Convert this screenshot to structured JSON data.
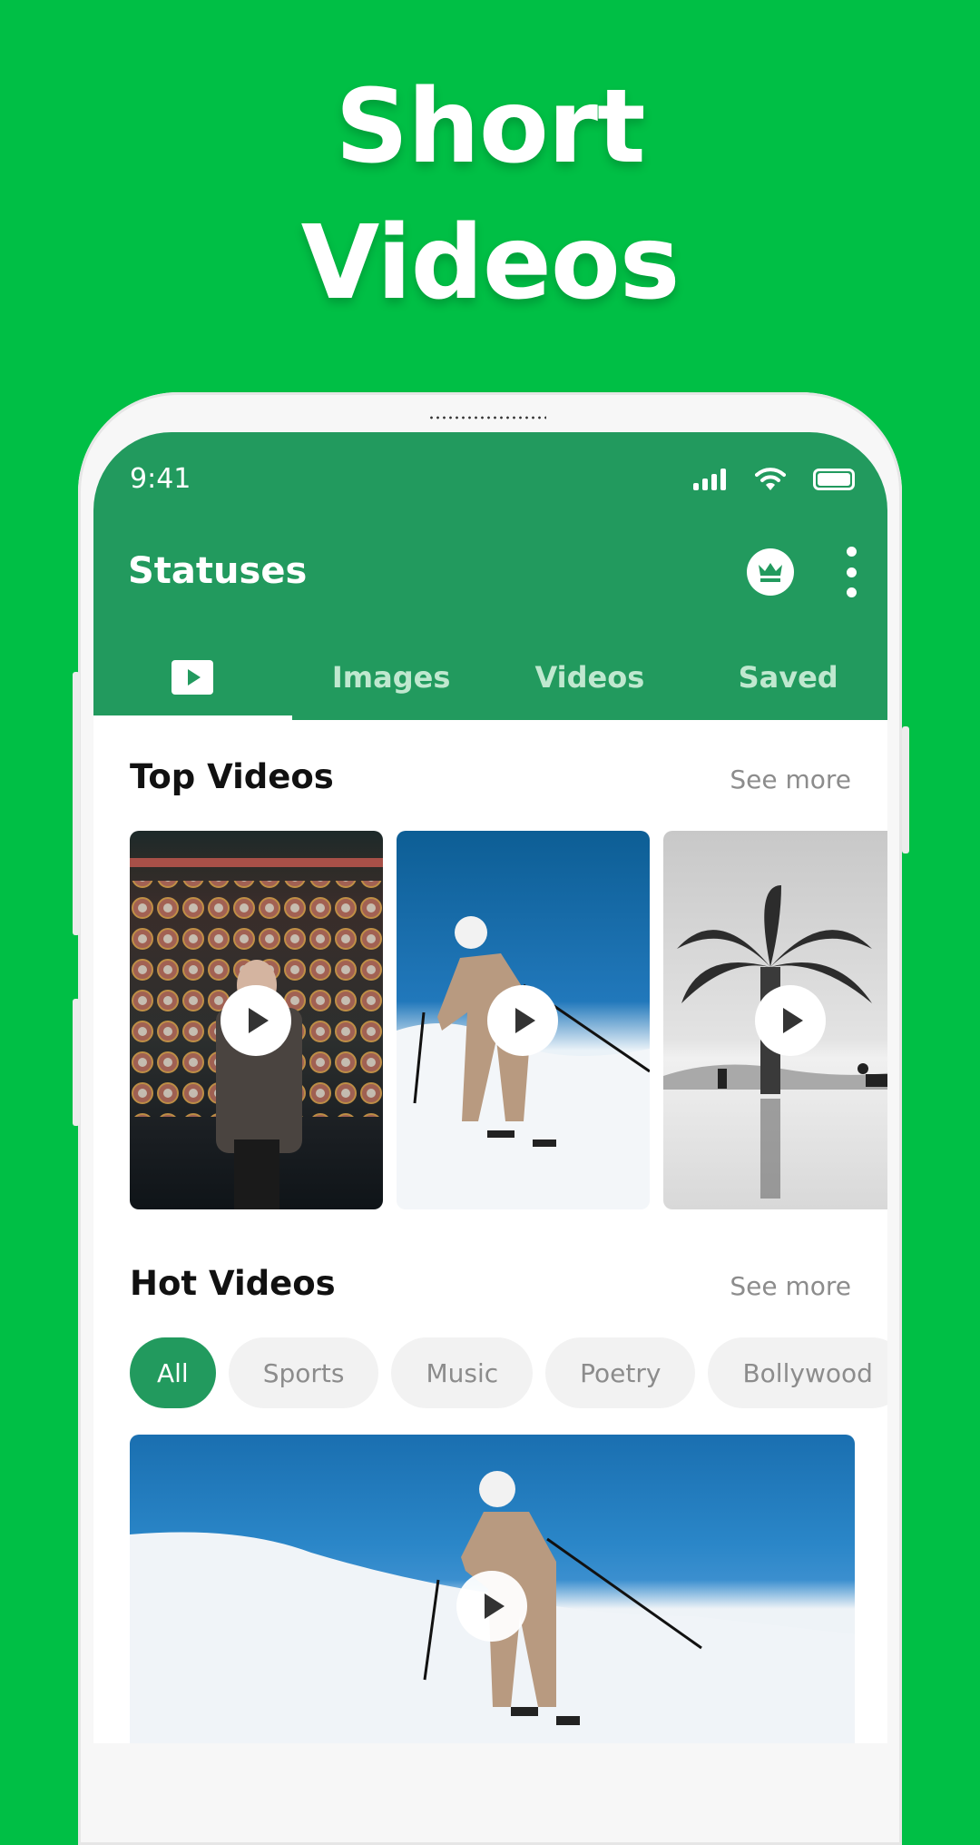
{
  "headline": {
    "line1": "Short",
    "line2": "Videos"
  },
  "status_bar": {
    "time": "9:41",
    "icons": [
      "signal-icon",
      "wifi-icon",
      "battery-icon"
    ]
  },
  "app_bar": {
    "title": "Statuses",
    "premium_icon": "crown-icon",
    "menu_icon": "more-vertical-icon"
  },
  "tabs": [
    {
      "label": "",
      "icon": "play-icon",
      "active": true
    },
    {
      "label": "Images",
      "active": false
    },
    {
      "label": "Videos",
      "active": false
    },
    {
      "label": "Saved",
      "active": false
    }
  ],
  "top_videos": {
    "title": "Top Videos",
    "see_more": "See more",
    "items": [
      {
        "subject": "man in suit before machine wall"
      },
      {
        "subject": "skier on snowy slope"
      },
      {
        "subject": "palm tree black and white reflection"
      }
    ]
  },
  "hot_videos": {
    "title": "Hot Videos",
    "see_more": "See more",
    "filters": [
      {
        "label": "All",
        "active": true
      },
      {
        "label": "Sports",
        "active": false
      },
      {
        "label": "Music",
        "active": false
      },
      {
        "label": "Poetry",
        "active": false
      },
      {
        "label": "Bollywood",
        "active": false
      }
    ],
    "featured": {
      "subject": "skier on snowy slope"
    }
  },
  "colors": {
    "background": "#00bf45",
    "primary": "#229a5e",
    "tab_inactive": "#bfe8cf",
    "muted_text": "#8c8c8c"
  }
}
